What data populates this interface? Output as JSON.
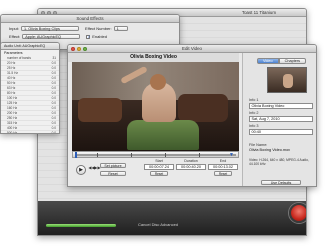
{
  "toast_window": {
    "title": "Toast 11 Titanium",
    "bottom_text": "Cancel   Disc   Advanced"
  },
  "sound_effects": {
    "title": "Sound Effects",
    "input_label": "Input:",
    "input_value": "1. Olivia Boxing Clips",
    "effect_number_label": "Effect Number:",
    "effect_number_value": "1",
    "effect_label": "Effect:",
    "effect_value": "Apple: AUGraphicEQ",
    "enabled_label": "Enabled",
    "enabled": true
  },
  "audio_unit": {
    "title": "Audio Unit: AUGraphicEQ",
    "parameters_label": "Parameters",
    "band_count_label": "number of bands",
    "band_count_value": "31",
    "bands": [
      {
        "label": "20 Hz",
        "value": "0.0"
      },
      {
        "label": "25 Hz",
        "value": "0.0"
      },
      {
        "label": "31.5 Hz",
        "value": "0.0"
      },
      {
        "label": "40 Hz",
        "value": "0.0"
      },
      {
        "label": "50 Hz",
        "value": "0.0"
      },
      {
        "label": "63 Hz",
        "value": "0.0"
      },
      {
        "label": "80 Hz",
        "value": "0.0"
      },
      {
        "label": "100 Hz",
        "value": "0.0"
      },
      {
        "label": "125 Hz",
        "value": "0.0"
      },
      {
        "label": "160 Hz",
        "value": "0.0"
      },
      {
        "label": "200 Hz",
        "value": "0.0"
      },
      {
        "label": "250 Hz",
        "value": "0.0"
      },
      {
        "label": "315 Hz",
        "value": "0.0"
      },
      {
        "label": "400 Hz",
        "value": "0.0"
      },
      {
        "label": "500 Hz",
        "value": "0.0"
      }
    ]
  },
  "edit_video": {
    "title": "Edit Video",
    "video_title": "Olivia Boxing Video",
    "controls": {
      "play_glyph": "▶",
      "rewind_glyph": "◀◀",
      "forward_glyph": "▶▶",
      "set_picture_label": "Set picture",
      "reset_label": "Reset",
      "start_label": "Start",
      "start_value": "00:00:07.24",
      "duration_label": "Duration",
      "duration_value": "00:00:40.20",
      "end_label": "End",
      "end_value": "00:00:13.02",
      "set_label": "Reset"
    },
    "inspector": {
      "tabs": [
        "Video",
        "Chapters"
      ],
      "active_tab": "Video",
      "info1_label": "Info 1",
      "info1_value": "Olivia Boxing Video",
      "info2_label": "Info 2",
      "info2_value": "Sat, Aug 7, 2010",
      "info3_label": "Info 3",
      "info3_value": "00:40",
      "file_name_label": "File Name:",
      "file_name_value": "Olivia Boxing Video.mov",
      "file_details": "Video: H.264, 640 x 480, MPEG-4 Audio, 44.100 kHz",
      "use_defaults_label": "Use Defaults"
    }
  }
}
